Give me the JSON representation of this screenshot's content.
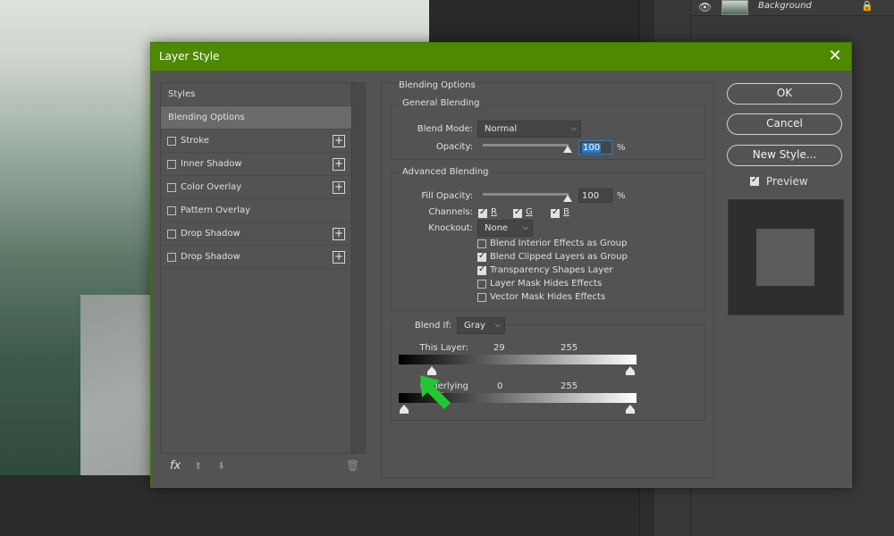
{
  "layers_panel": {
    "layer_name": "Background",
    "icons": {
      "eye": "eye-icon",
      "lock": "lock-icon"
    }
  },
  "dialog": {
    "title": "Layer Style",
    "close_glyph": "✕",
    "accent_color": "#4e8a00"
  },
  "styles_list": {
    "header": "Styles",
    "items": [
      {
        "label": "Blending Options",
        "checkbox": false,
        "plus": false,
        "selected": true
      },
      {
        "label": "Stroke",
        "checkbox": true,
        "plus": true
      },
      {
        "label": "Inner Shadow",
        "checkbox": true,
        "plus": true
      },
      {
        "label": "Color Overlay",
        "checkbox": true,
        "plus": true
      },
      {
        "label": "Pattern Overlay",
        "checkbox": true,
        "plus": false
      },
      {
        "label": "Drop Shadow",
        "checkbox": true,
        "plus": true
      },
      {
        "label": "Drop Shadow",
        "checkbox": true,
        "plus": true
      }
    ],
    "footer": {
      "fx": "fx",
      "up": "⬆",
      "down": "⬇",
      "trash": "🗑"
    }
  },
  "options": {
    "title": "Blending Options",
    "general": {
      "title": "General Blending",
      "blend_mode_label": "Blend Mode:",
      "blend_mode_value": "Normal",
      "opacity_label": "Opacity:",
      "opacity_value": "100",
      "pct": "%"
    },
    "advanced": {
      "title": "Advanced Blending",
      "fill_opacity_label": "Fill Opacity:",
      "fill_opacity_value": "100",
      "pct": "%",
      "channels_label": "Channels:",
      "channels": [
        "R",
        "G",
        "B"
      ],
      "knockout_label": "Knockout:",
      "knockout_value": "None",
      "checks": [
        {
          "label": "Blend Interior Effects as Group",
          "checked": false
        },
        {
          "label": "Blend Clipped Layers as Group",
          "checked": true
        },
        {
          "label": "Transparency Shapes Layer",
          "checked": true
        },
        {
          "label": "Layer Mask Hides Effects",
          "checked": false
        },
        {
          "label": "Vector Mask Hides Effects",
          "checked": false
        }
      ]
    },
    "blend_if": {
      "label": "Blend If:",
      "value": "Gray",
      "this_layer_label": "This Layer:",
      "this_layer_low": "29",
      "this_layer_high": "255",
      "underlying_label": "Underlying Layer:",
      "underlying_low": "0",
      "underlying_high": "255"
    }
  },
  "buttons": {
    "ok": "OK",
    "cancel": "Cancel",
    "new_style": "New Style...",
    "preview_label": "Preview"
  }
}
